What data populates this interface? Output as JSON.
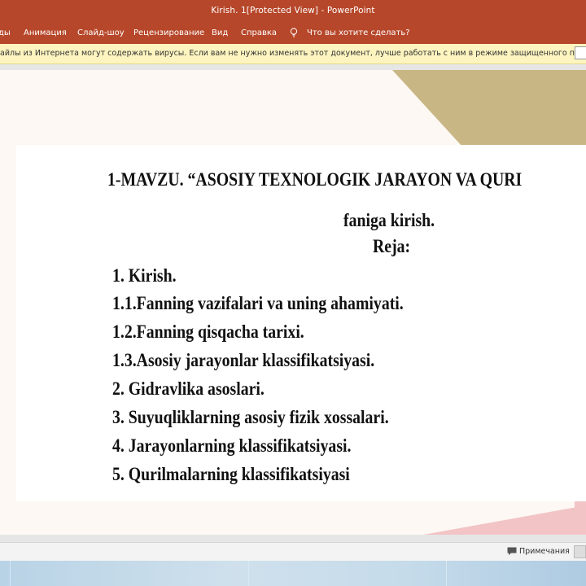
{
  "window": {
    "title": "Kirish. 1[Protected View]  -  PowerPoint"
  },
  "ribbon": {
    "tabs": [
      {
        "label": "ды"
      },
      {
        "label": "Анимация"
      },
      {
        "label": "Слайд-шоу"
      },
      {
        "label": "Рецензирование"
      },
      {
        "label": "Вид"
      },
      {
        "label": "Справка"
      }
    ],
    "tell_me": "Что вы хотите сделать?",
    "accent": "#b7472a"
  },
  "protected_view": {
    "message": "айлы из Интернета могут содержать вирусы. Если вам не нужно изменять этот документ, лучше работать с ним в режиме защищенного просмотра."
  },
  "slide": {
    "title": "1-MAVZU. “ASOSIY TEXNOLOGIK  JARAYON VA QURI",
    "subtitle": "faniga kirish.",
    "plan_heading": "Reja:",
    "items": [
      "1.  Kirish.",
      "1.1.Fanning vazifalari va uning ahamiyati.",
      "1.2.Fanning qisqacha tarixi.",
      "1.3.Asosiy jarayonlar klassifikatsiyasi.",
      " 2. Gidravlika asoslari.",
      " 3. Suyuqliklarning asosiy fizik xossalari.",
      " 4. Jarayonlarning klassifikatsiyasi.",
      " 5. Qurilmalarning klassifikatsiyasi"
    ],
    "colors": {
      "gold": "#c9b685",
      "pink": "#f2c4c6",
      "background": "#fdf8f3"
    }
  },
  "statusbar": {
    "notes_label": "Примечания"
  }
}
